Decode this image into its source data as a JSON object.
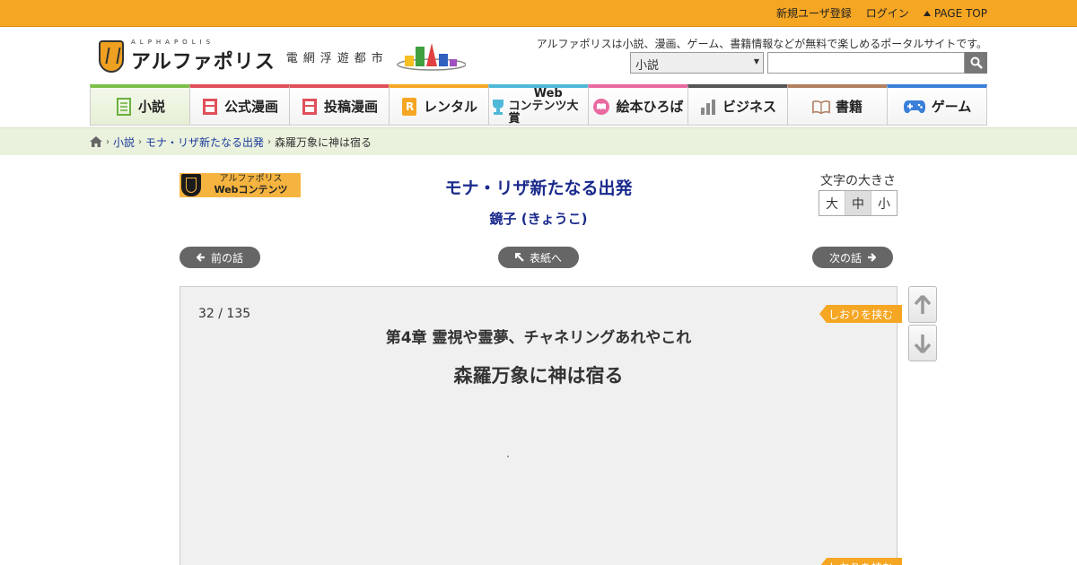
{
  "topbar": {
    "register": "新規ユーザ登録",
    "login": "ログイン",
    "page_top": "PAGE TOP"
  },
  "header": {
    "logo_small": "ALPHAPOLIS",
    "logo_main": "アルファポリス",
    "logo_sub": "電網浮遊都市",
    "tagline": "アルファポリスは小説、漫画、ゲーム、書籍情報などが無料で楽しめるポータルサイトです。",
    "search_category": "小説",
    "search_value": ""
  },
  "nav": {
    "items": [
      {
        "label": "小説",
        "color": "#7cc04a"
      },
      {
        "label": "公式漫画",
        "color": "#e0505a"
      },
      {
        "label": "投稿漫画",
        "color": "#e0505a"
      },
      {
        "label": "レンタル",
        "color": "#f5a623"
      },
      {
        "label_top": "Web",
        "label_bottom": "コンテンツ大賞",
        "color": "#4fb8d8"
      },
      {
        "label": "絵本ひろば",
        "color": "#e86aa0"
      },
      {
        "label": "ビジネス",
        "color": "#555555"
      },
      {
        "label": "書籍",
        "color": "#b08060"
      },
      {
        "label": "ゲーム",
        "color": "#3a7fd8"
      }
    ]
  },
  "breadcrumb": {
    "items": [
      "小説",
      "モナ・リザ新たなる出発"
    ],
    "current": "森羅万象に神は宿る"
  },
  "badge": {
    "line1": "アルファポリス",
    "line2": "Webコンテンツ"
  },
  "novel": {
    "title": "モナ・リザ新たなる出発",
    "author": "鏡子 (きょうこ)"
  },
  "fontsize": {
    "label": "文字の大きさ",
    "large": "大",
    "medium": "中",
    "small": "小",
    "selected": "中"
  },
  "pager": {
    "prev": "前の話",
    "cover": "表紙へ",
    "next": "次の話"
  },
  "reader": {
    "page_current": "32",
    "page_total": "135",
    "page_display": "32 / 135",
    "chapter": "第4章 霊視や霊夢、チャネリングあれやこれ",
    "episode": "森羅万象に神は宿る",
    "bookmark_label": "しおりを挟む"
  },
  "colors": {
    "topbar": "#f5a623",
    "breadcrumb_bg": "#eaf1dd",
    "title": "#1a2a8c",
    "link": "#1a3a9c"
  }
}
